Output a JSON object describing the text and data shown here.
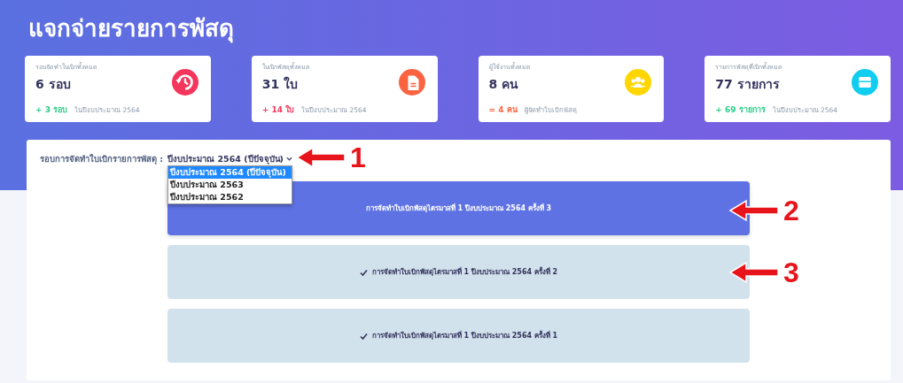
{
  "page": {
    "title": "แจกจ่ายรายการพัสดุ"
  },
  "stats": [
    {
      "label": "รอบจัดทำใบเบิกทั้งหมด",
      "value": "6 รอบ",
      "change": {
        "text": "+ 3 รอบ",
        "color": "#2dce89"
      },
      "note": "ในปีงบประมาณ 2564",
      "color": "#f5365c",
      "kind": "history"
    },
    {
      "label": "ใบเบิกพัสดุทั้งหมด",
      "value": "31 ใบ",
      "change": {
        "text": "+ 14 ใบ",
        "color": "#f5365c"
      },
      "note": "ในปีงบประมาณ 2564",
      "color": "#fb6340",
      "kind": "document"
    },
    {
      "label": "ผู้ใช้งานทั้งหมด",
      "value": "8 คน",
      "change": {
        "text": "= 4 คน",
        "color": "#fb6340"
      },
      "note": "ผู้จัดทำใบเบิกพัสดุ",
      "color": "#ffd600",
      "kind": "users"
    },
    {
      "label": "รายการพัสดุที่เบิกทั้งหมด",
      "value": "77 รายการ",
      "change": {
        "text": "+ 69 รายการ",
        "color": "#2dce89"
      },
      "note": "ในปีงบประมาณ 2564",
      "color": "#11cdef",
      "kind": "box"
    }
  ],
  "filter": {
    "label": "รอบการจัดทำใบเบิกรายการพัสดุ :",
    "value": "ปีงบประมาณ 2564 (ปีปัจจุบัน)",
    "options": [
      {
        "label": "ปีงบประมาณ 2564 (ปีปัจจุบัน)",
        "selected": true
      },
      {
        "label": "ปีงบประมาณ 2563",
        "selected": false
      },
      {
        "label": "ปีงบประมาณ 2562",
        "selected": false
      }
    ]
  },
  "rounds": [
    {
      "title": "การจัดทำใบเบิกพัสดุไตรมาสที่ 1 ปีงบประมาณ 2564 ครั้งที่ 3",
      "selected": true,
      "done": false
    },
    {
      "title": "การจัดทำใบเบิกพัสดุไตรมาสที่ 1 ปีงบประมาณ 2564 ครั้งที่ 2",
      "selected": false,
      "done": true
    },
    {
      "title": "การจัดทำใบเบิกพัสดุไตรมาสที่ 1 ปีงบประมาณ 2564 ครั้งที่ 1",
      "selected": false,
      "done": true
    }
  ],
  "annotations": [
    {
      "label": "1"
    },
    {
      "label": "2"
    },
    {
      "label": "3"
    }
  ]
}
